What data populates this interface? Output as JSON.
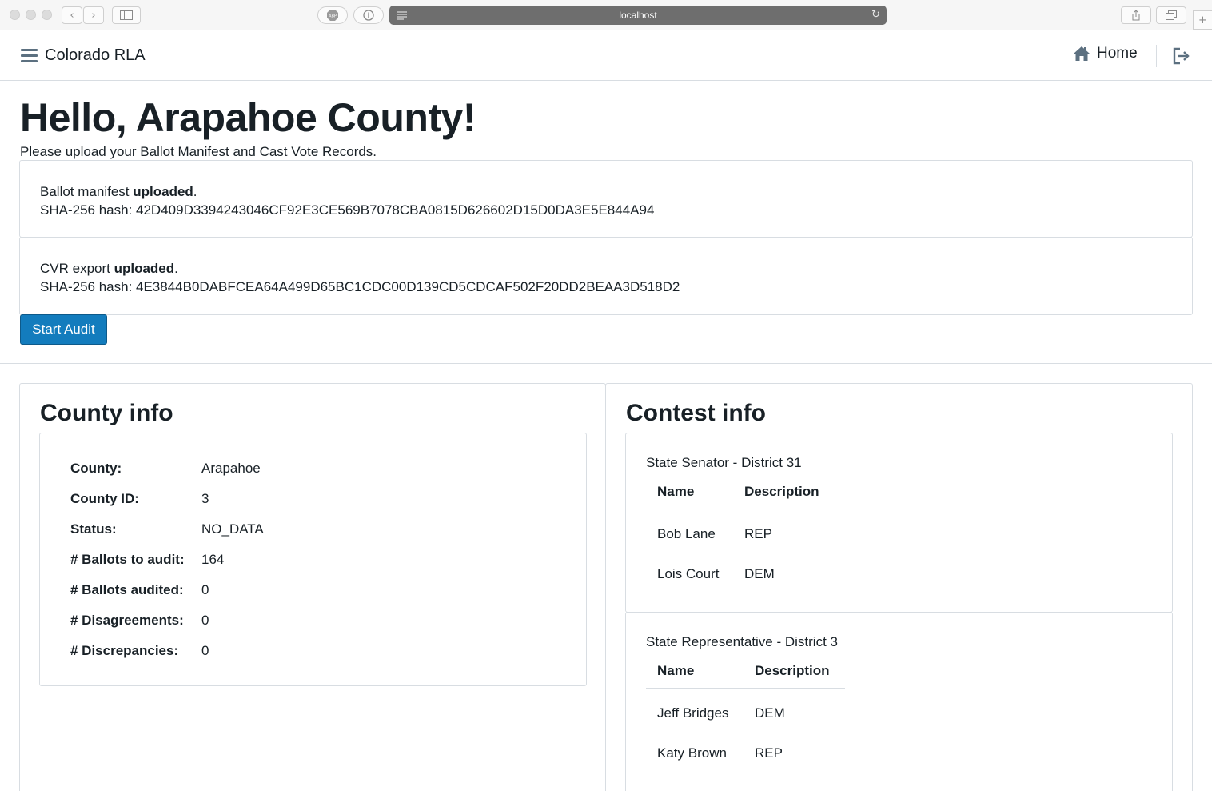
{
  "browser": {
    "url": "localhost",
    "icons": [
      "back-icon",
      "forward-icon",
      "sidebar-icon",
      "adblock-icon",
      "info-icon",
      "reader-icon",
      "reload-icon",
      "share-icon",
      "tabs-icon",
      "new-tab-icon"
    ]
  },
  "navbar": {
    "brand": "Colorado RLA",
    "home_label": "Home"
  },
  "page": {
    "greeting": "Hello, Arapahoe County!",
    "instructions": "Please upload your Ballot Manifest and Cast Vote Records."
  },
  "uploads": {
    "manifest": {
      "prefix": "Ballot manifest ",
      "status": "uploaded",
      "suffix": ".",
      "hash_label": "SHA-256 hash: ",
      "hash": "42D409D3394243046CF92E3CE569B7078CBA0815D626602D15D0DA3E5E844A94"
    },
    "cvr": {
      "prefix": "CVR export ",
      "status": "uploaded",
      "suffix": ".",
      "hash_label": "SHA-256 hash: ",
      "hash": "4E3844B0DABFCEA64A499D65BC1CDC00D139CD5CDCAF502F20DD2BEAA3D518D2"
    }
  },
  "start_audit_label": "Start Audit",
  "county_info": {
    "title": "County info",
    "rows": [
      {
        "key": "County:",
        "value": "Arapahoe"
      },
      {
        "key": "County ID:",
        "value": "3"
      },
      {
        "key": "Status:",
        "value": "NO_DATA"
      },
      {
        "key": "# Ballots to audit:",
        "value": "164"
      },
      {
        "key": "# Ballots audited:",
        "value": "0"
      },
      {
        "key": "# Disagreements:",
        "value": "0"
      },
      {
        "key": "# Discrepancies:",
        "value": "0"
      }
    ]
  },
  "contest_info": {
    "title": "Contest info",
    "contests": [
      {
        "name": "State Senator - District 31",
        "headers": [
          "Name",
          "Description"
        ],
        "choices": [
          {
            "name": "Bob Lane",
            "description": "REP"
          },
          {
            "name": "Lois Court",
            "description": "DEM"
          }
        ]
      },
      {
        "name": "State Representative - District 3",
        "headers": [
          "Name",
          "Description"
        ],
        "choices": [
          {
            "name": "Jeff Bridges",
            "description": "DEM"
          },
          {
            "name": "Katy Brown",
            "description": "REP"
          }
        ]
      }
    ]
  },
  "colors": {
    "primary": "#137cbd",
    "text": "#182026",
    "border": "#d8dde2",
    "icon": "#5c7080"
  }
}
